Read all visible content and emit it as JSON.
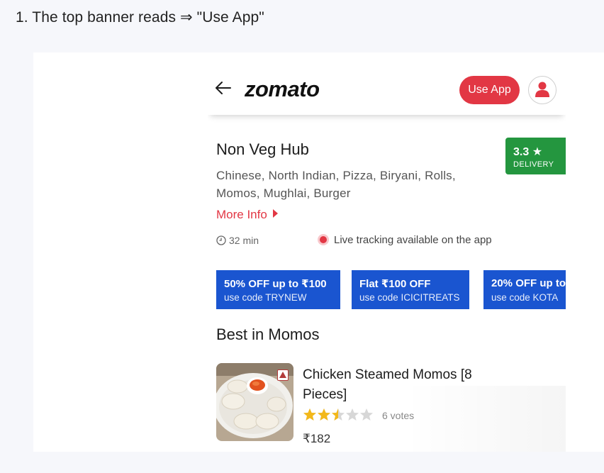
{
  "caption": "1. The top banner reads ⇒ \"Use App\"",
  "header": {
    "logo": "zomato",
    "use_app_label": "Use App",
    "back_icon": "arrow-left-icon",
    "avatar_icon": "user-icon"
  },
  "restaurant": {
    "name": "Non Veg Hub",
    "cuisines": "Chinese, North Indian, Pizza, Biryani, Rolls, Momos, Mughlai, Burger",
    "more_info": "More Info",
    "rating": "3.3",
    "rating_label": "DELIVERY",
    "delivery_time": "32 min",
    "live_tracking": "Live tracking available on the app"
  },
  "offers": [
    {
      "title": "50% OFF up to ₹100",
      "code": "use code TRYNEW"
    },
    {
      "title": "Flat ₹100 OFF",
      "code": "use code ICICITREATS"
    },
    {
      "title": "20% OFF up to",
      "code": "use code KOTA"
    }
  ],
  "section_title": "Best in Momos",
  "dish": {
    "name": "Chicken Steamed Momos [8 Pieces]",
    "rating_stars": 2.5,
    "votes": "6 votes",
    "price": "₹182"
  },
  "colors": {
    "brand_red": "#e23744",
    "rating_green": "#24963f",
    "offer_blue": "#1a55d0",
    "star_gold": "#f3b81a",
    "star_grey": "#d7d7d7"
  }
}
